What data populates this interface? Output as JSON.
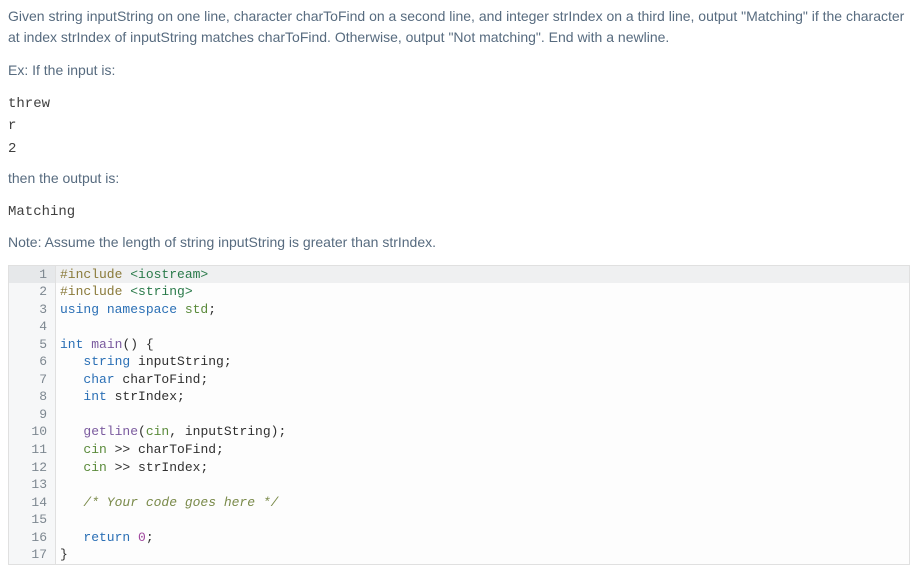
{
  "problem": {
    "description": "Given string inputString on one line, character charToFind on a second line, and integer strIndex on a third line, output \"Matching\" if the character at index strIndex of inputString matches charToFind. Otherwise, output \"Not matching\". End with a newline.",
    "example_prefix": "Ex: If the input is:",
    "example_input_line1": "threw",
    "example_input_line2": "r",
    "example_input_line3": "2",
    "example_mid": "then the output is:",
    "example_output": "Matching",
    "note": "Note: Assume the length of string inputString is greater than strIndex."
  },
  "code": {
    "lines": [
      {
        "n": "1",
        "hl": true,
        "tokens": [
          {
            "c": "tk-pre",
            "t": "#include "
          },
          {
            "c": "tk-sys",
            "t": "<iostream>"
          }
        ]
      },
      {
        "n": "2",
        "hl": false,
        "tokens": [
          {
            "c": "tk-pre",
            "t": "#include "
          },
          {
            "c": "tk-sys",
            "t": "<string>"
          }
        ]
      },
      {
        "n": "3",
        "hl": false,
        "tokens": [
          {
            "c": "tk-kw",
            "t": "using "
          },
          {
            "c": "tk-ns",
            "t": "namespace "
          },
          {
            "c": "tk-std",
            "t": "std"
          },
          {
            "c": "tk-punc",
            "t": ";"
          }
        ]
      },
      {
        "n": "4",
        "hl": false,
        "tokens": [
          {
            "c": "",
            "t": ""
          }
        ]
      },
      {
        "n": "5",
        "hl": false,
        "tokens": [
          {
            "c": "tk-type",
            "t": "int "
          },
          {
            "c": "tk-fn",
            "t": "main"
          },
          {
            "c": "tk-punc",
            "t": "() {"
          }
        ]
      },
      {
        "n": "6",
        "hl": false,
        "tokens": [
          {
            "c": "",
            "t": "   "
          },
          {
            "c": "tk-type",
            "t": "string "
          },
          {
            "c": "tk-id",
            "t": "inputString"
          },
          {
            "c": "tk-punc",
            "t": ";"
          }
        ]
      },
      {
        "n": "7",
        "hl": false,
        "tokens": [
          {
            "c": "",
            "t": "   "
          },
          {
            "c": "tk-type",
            "t": "char "
          },
          {
            "c": "tk-id",
            "t": "charToFind"
          },
          {
            "c": "tk-punc",
            "t": ";"
          }
        ]
      },
      {
        "n": "8",
        "hl": false,
        "tokens": [
          {
            "c": "",
            "t": "   "
          },
          {
            "c": "tk-type",
            "t": "int "
          },
          {
            "c": "tk-id",
            "t": "strIndex"
          },
          {
            "c": "tk-punc",
            "t": ";"
          }
        ]
      },
      {
        "n": "9",
        "hl": false,
        "tokens": [
          {
            "c": "",
            "t": ""
          }
        ]
      },
      {
        "n": "10",
        "hl": false,
        "tokens": [
          {
            "c": "",
            "t": "   "
          },
          {
            "c": "tk-fn",
            "t": "getline"
          },
          {
            "c": "tk-punc",
            "t": "("
          },
          {
            "c": "tk-std",
            "t": "cin"
          },
          {
            "c": "tk-punc",
            "t": ", "
          },
          {
            "c": "tk-id",
            "t": "inputString"
          },
          {
            "c": "tk-punc",
            "t": ");"
          }
        ]
      },
      {
        "n": "11",
        "hl": false,
        "tokens": [
          {
            "c": "",
            "t": "   "
          },
          {
            "c": "tk-std",
            "t": "cin"
          },
          {
            "c": "tk-punc",
            "t": " >> "
          },
          {
            "c": "tk-id",
            "t": "charToFind"
          },
          {
            "c": "tk-punc",
            "t": ";"
          }
        ]
      },
      {
        "n": "12",
        "hl": false,
        "tokens": [
          {
            "c": "",
            "t": "   "
          },
          {
            "c": "tk-std",
            "t": "cin"
          },
          {
            "c": "tk-punc",
            "t": " >> "
          },
          {
            "c": "tk-id",
            "t": "strIndex"
          },
          {
            "c": "tk-punc",
            "t": ";"
          }
        ]
      },
      {
        "n": "13",
        "hl": false,
        "tokens": [
          {
            "c": "",
            "t": ""
          }
        ]
      },
      {
        "n": "14",
        "hl": false,
        "tokens": [
          {
            "c": "",
            "t": "   "
          },
          {
            "c": "tk-cmt",
            "t": "/* Your code goes here */"
          }
        ]
      },
      {
        "n": "15",
        "hl": false,
        "tokens": [
          {
            "c": "",
            "t": ""
          }
        ]
      },
      {
        "n": "16",
        "hl": false,
        "tokens": [
          {
            "c": "",
            "t": "   "
          },
          {
            "c": "tk-kw",
            "t": "return "
          },
          {
            "c": "tk-num",
            "t": "0"
          },
          {
            "c": "tk-punc",
            "t": ";"
          }
        ]
      },
      {
        "n": "17",
        "hl": false,
        "tokens": [
          {
            "c": "tk-punc",
            "t": "}"
          }
        ]
      }
    ]
  }
}
